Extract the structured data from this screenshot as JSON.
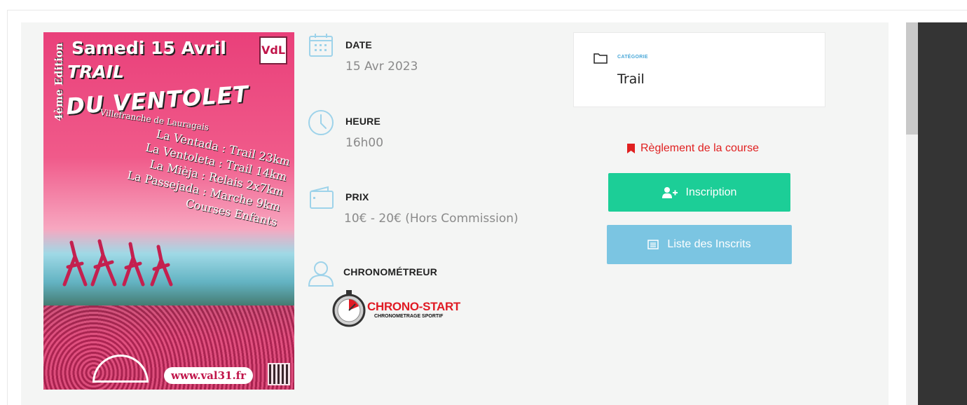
{
  "poster": {
    "edition": "4ème Edition",
    "date_text": "Samedi 15 Avril",
    "title_line1": "TRAIL",
    "title_line2": "DU VENTOLET",
    "subtitle": "Villefranche de Lauragais",
    "races": [
      "La Ventada : Trail 23km",
      "La Ventoleta : Trail 14km",
      "La Mièja : Relais 2x7km",
      "La Passejada : Marche 9km",
      "Courses Enfants"
    ],
    "logo_text": "VdL",
    "url": "www.val31.fr"
  },
  "info": {
    "date": {
      "label": "DATE",
      "value": "15 Avr 2023",
      "icon": "calendar-icon"
    },
    "time": {
      "label": "HEURE",
      "value": "16h00",
      "icon": "clock-icon"
    },
    "price": {
      "label": "PRIX",
      "value": "10€ - 20€ (Hors Commission)",
      "icon": "wallet-icon"
    },
    "timer": {
      "label": "CHRONOMÉTREUR",
      "icon": "user-icon"
    }
  },
  "chrono": {
    "name": "CHRONO-START",
    "tagline": "CHRONOMETRAGE SPORTIF"
  },
  "category": {
    "label": "CATÉGORIE",
    "value": "Trail",
    "icon": "folder-icon"
  },
  "rules_link": {
    "label": "Règlement de la course",
    "icon": "bookmark-icon"
  },
  "buttons": {
    "register": {
      "label": "Inscription",
      "icon": "user-plus-icon"
    },
    "registered_list": {
      "label": "Liste des Inscrits",
      "icon": "list-icon"
    }
  },
  "colors": {
    "accent_green": "#1cce97",
    "accent_blue": "#7bc5e2",
    "link_red": "#e02020",
    "icon_blue": "#9ed3ea"
  }
}
